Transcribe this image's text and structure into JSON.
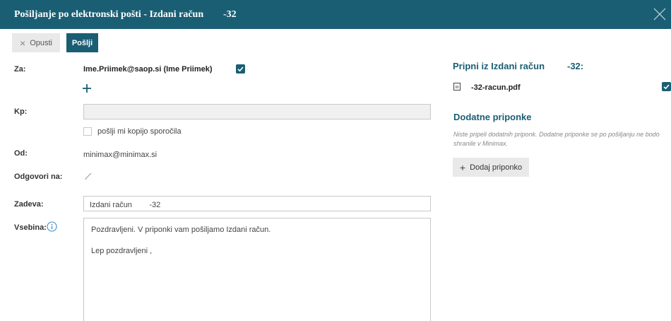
{
  "dialog": {
    "title": "Pošiljanje po elektronski pošti - Izdani račun",
    "title_number": "-32",
    "close_icon": "close-icon"
  },
  "toolbar": {
    "cancel_label": "Opusti",
    "send_label": "Pošlji"
  },
  "form": {
    "to_label": "Za:",
    "to_value": "Ime.Priimek@saop.si (Ime Priimek)",
    "to_checked": true,
    "cc_label": "Kp:",
    "cc_value": "",
    "send_copy_label": "pošlji mi kopijo sporočila",
    "send_copy_checked": false,
    "from_label": "Od:",
    "from_value": "minimax@minimax.si",
    "reply_to_label": "Odgovori na:",
    "subject_label": "Zadeva:",
    "subject_value": "Izdani račun        -32",
    "body_label": "Vsebina:",
    "body_line1": "Pozdravljeni. V priponki vam pošiljamo Izdani račun.",
    "body_line2": "Lep pozdravljeni ,"
  },
  "attachments": {
    "heading": "Pripni iz Izdani račun",
    "heading_number": "-32:",
    "file_name": "-32-racun.pdf",
    "file_checked": true,
    "extra_heading": "Dodatne priponke",
    "extra_note": "Niste pripeli dodatnih priponk. Dodatne priponke se po pošiljanju ne bodo shranile v Minimax.",
    "add_button_label": "Dodaj priponko"
  },
  "colors": {
    "accent": "#1a5e74",
    "button_gray": "#e9e9e9"
  }
}
